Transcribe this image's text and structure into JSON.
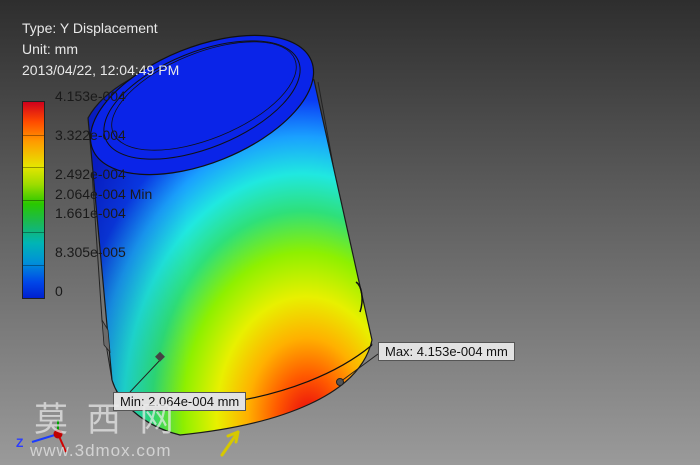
{
  "info": {
    "type_line": "Type: Y Displacement",
    "unit_line": "Unit: mm",
    "timestamp": "2013/04/22, 12:04:49 PM"
  },
  "scale": {
    "labels": [
      "4.153e-004",
      "3.322e-004",
      "2.492e-004",
      "2.064e-004 Min",
      "1.661e-004",
      "8.305e-005",
      "0"
    ]
  },
  "probes": {
    "max_label": "Max: 4.153e-004 mm",
    "min_label": "Min: 2.064e-004 mm"
  },
  "watermark": {
    "cjk": "莫 西 网",
    "site": "www.3dmox.com"
  },
  "axes": {
    "z_label": "Z"
  },
  "colors": {
    "scale_top": "#d0001c",
    "scale_bottom": "#0020d0",
    "model_blue": "#0a2af0"
  }
}
